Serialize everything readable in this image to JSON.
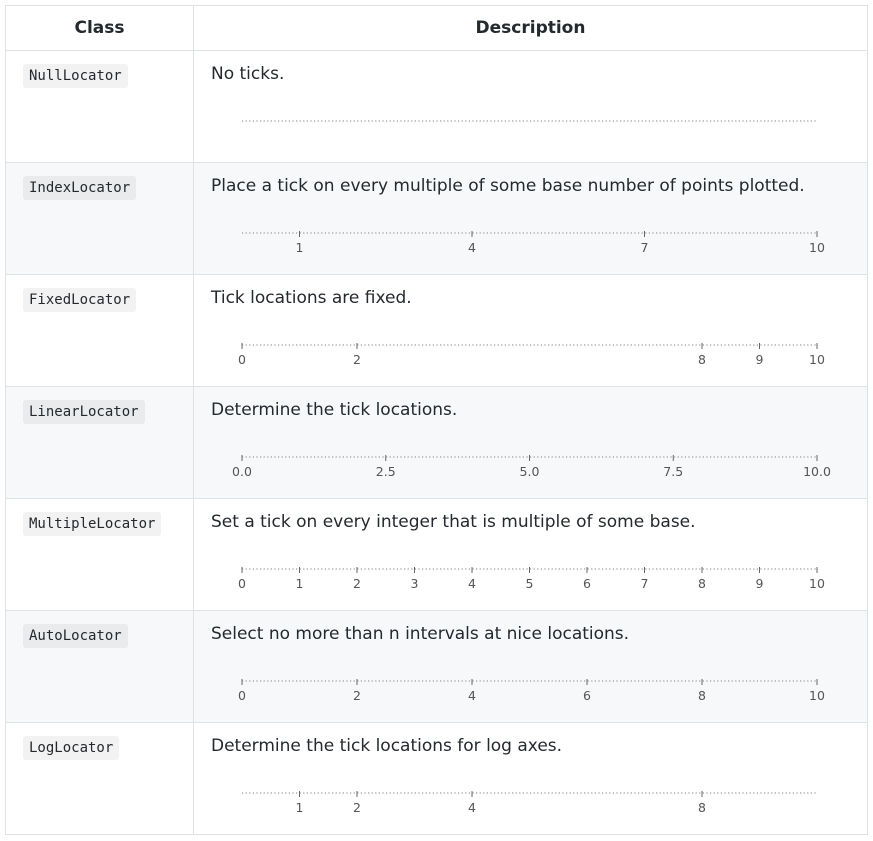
{
  "table": {
    "headers": {
      "class": "Class",
      "description": "Description"
    },
    "rows": [
      {
        "class": "NullLocator",
        "description": "No ticks.",
        "axis": {
          "min": 0,
          "max": 10,
          "ticks": [],
          "labels": []
        }
      },
      {
        "class": "IndexLocator",
        "description": "Place a tick on every multiple of some base number of points plotted.",
        "axis": {
          "min": 0,
          "max": 10,
          "ticks": [
            1,
            4,
            7,
            10
          ],
          "labels": [
            "1",
            "4",
            "7",
            "10"
          ]
        }
      },
      {
        "class": "FixedLocator",
        "description": "Tick locations are fixed.",
        "axis": {
          "min": 0,
          "max": 10,
          "ticks": [
            0,
            2,
            8,
            9,
            10
          ],
          "labels": [
            "0",
            "2",
            "8",
            "9",
            "10"
          ]
        }
      },
      {
        "class": "LinearLocator",
        "description": "Determine the tick locations.",
        "axis": {
          "min": 0,
          "max": 10,
          "ticks": [
            0,
            2.5,
            5,
            7.5,
            10
          ],
          "labels": [
            "0.0",
            "2.5",
            "5.0",
            "7.5",
            "10.0"
          ]
        }
      },
      {
        "class": "MultipleLocator",
        "description": "Set a tick on every integer that is multiple of some base.",
        "axis": {
          "min": 0,
          "max": 10,
          "ticks": [
            0,
            1,
            2,
            3,
            4,
            5,
            6,
            7,
            8,
            9,
            10
          ],
          "labels": [
            "0",
            "1",
            "2",
            "3",
            "4",
            "5",
            "6",
            "7",
            "8",
            "9",
            "10"
          ]
        }
      },
      {
        "class": "AutoLocator",
        "description": "Select no more than n intervals at nice locations.",
        "axis": {
          "min": 0,
          "max": 10,
          "ticks": [
            0,
            2,
            4,
            6,
            8,
            10
          ],
          "labels": [
            "0",
            "2",
            "4",
            "6",
            "8",
            "10"
          ]
        }
      },
      {
        "class": "LogLocator",
        "description": "Determine the tick locations for log axes.",
        "axis": {
          "min": 0,
          "max": 10,
          "ticks": [
            1,
            2,
            4,
            8
          ],
          "labels": [
            "1",
            "2",
            "4",
            "8"
          ]
        }
      }
    ]
  },
  "colors": {
    "border": "#dfe2e5",
    "stripe": "#f6f8fa",
    "axis_line": "#9a9a9a",
    "tick_text": "#555555"
  }
}
